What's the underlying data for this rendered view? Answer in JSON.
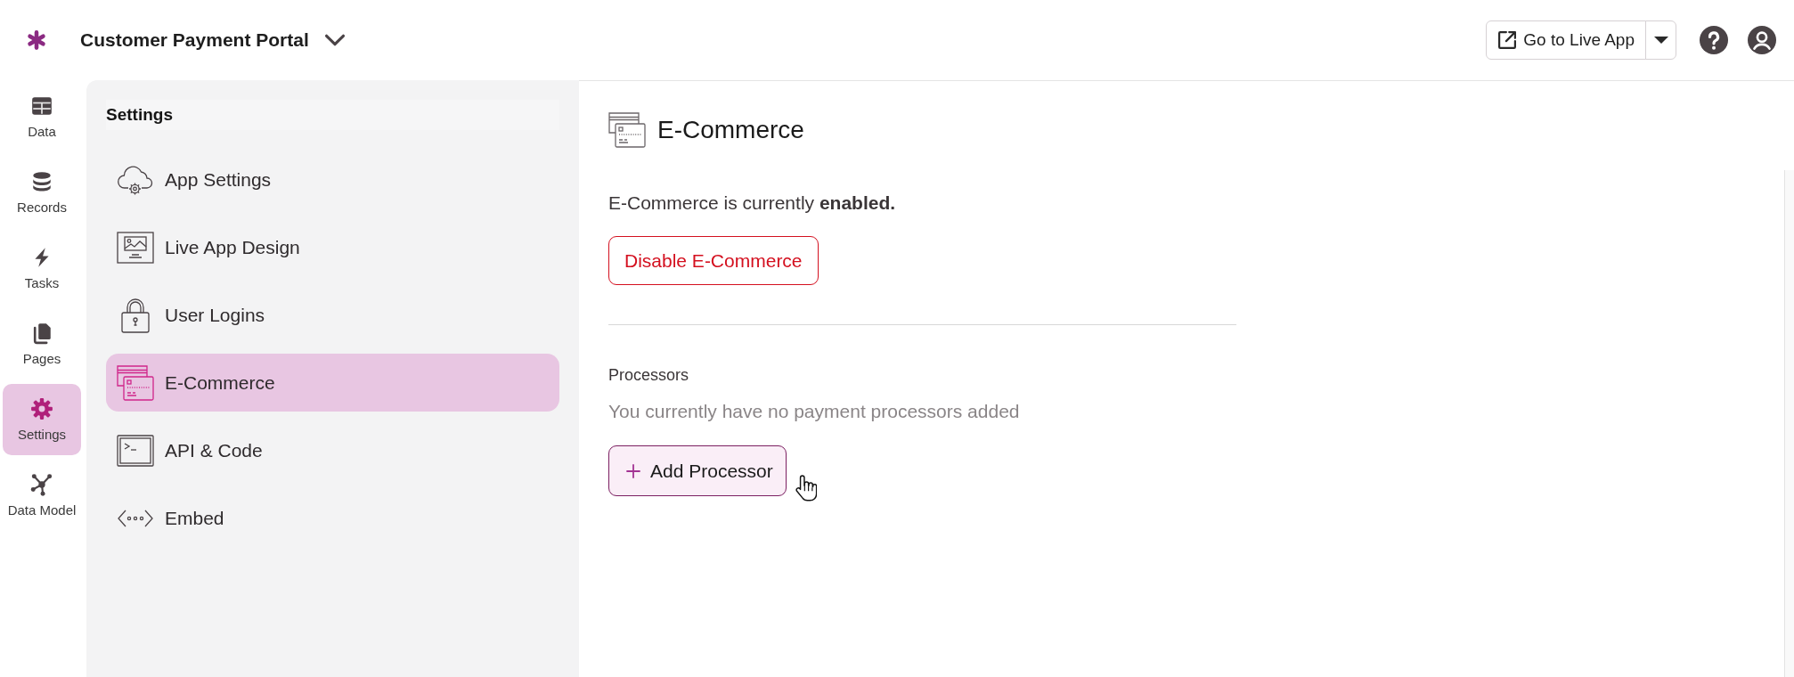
{
  "header": {
    "app_title": "Customer Payment Portal",
    "live_app_button": "Go to Live App"
  },
  "nav_rail": [
    {
      "label": "Data",
      "selected": false
    },
    {
      "label": "Records",
      "selected": false
    },
    {
      "label": "Tasks",
      "selected": false
    },
    {
      "label": "Pages",
      "selected": false
    },
    {
      "label": "Settings",
      "selected": true
    },
    {
      "label": "Data Model",
      "selected": false
    }
  ],
  "settings_menu": {
    "title": "Settings",
    "items": [
      {
        "label": "App Settings",
        "selected": false
      },
      {
        "label": "Live App Design",
        "selected": false
      },
      {
        "label": "User Logins",
        "selected": false
      },
      {
        "label": "E-Commerce",
        "selected": true
      },
      {
        "label": "API & Code",
        "selected": false
      },
      {
        "label": "Embed",
        "selected": false
      }
    ]
  },
  "content": {
    "title": "E-Commerce",
    "status_text": "E-Commerce is currently **enabled.**",
    "disable_button": "Disable E-Commerce",
    "processors": {
      "label": "Processors",
      "empty_text": "You currently have no payment processors added",
      "add_button": "Add Processor"
    }
  }
}
